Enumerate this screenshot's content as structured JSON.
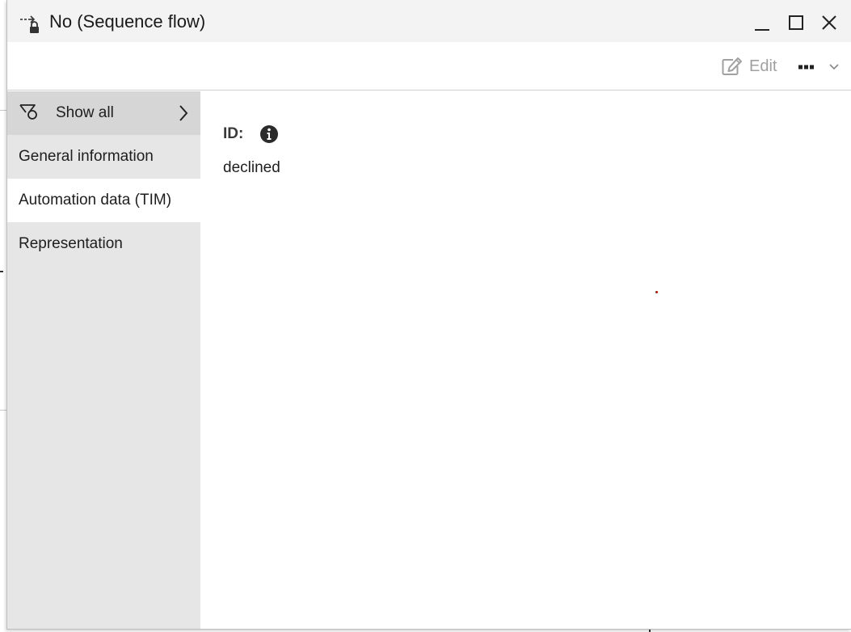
{
  "window": {
    "title": "No (Sequence flow)",
    "title_icon": "sequence-flow-locked-icon",
    "controls": [
      "minimize-icon",
      "maximize-icon",
      "close-icon"
    ]
  },
  "toolbar": {
    "edit_label": "Edit",
    "edit_icon": "edit-icon",
    "more_icon": "ellipsis-icon",
    "dropdown_icon": "chevron-down-icon"
  },
  "sidebar": {
    "show_all_label": "Show all",
    "show_all_icon": "filter-icon",
    "items": [
      {
        "label": "General information"
      },
      {
        "label": "Automation data (TIM)",
        "active": true
      },
      {
        "label": "Representation"
      }
    ]
  },
  "details": {
    "id_label": "ID:",
    "id_value": "declined"
  },
  "colors": {
    "titlebar_bg": "#f3f3f3",
    "sidebar_bg": "#e6e6e6",
    "sidebar_header_bg": "#d6d6d6",
    "active_item_bg": "#ffffff",
    "disabled_text": "#a0a0a0"
  }
}
